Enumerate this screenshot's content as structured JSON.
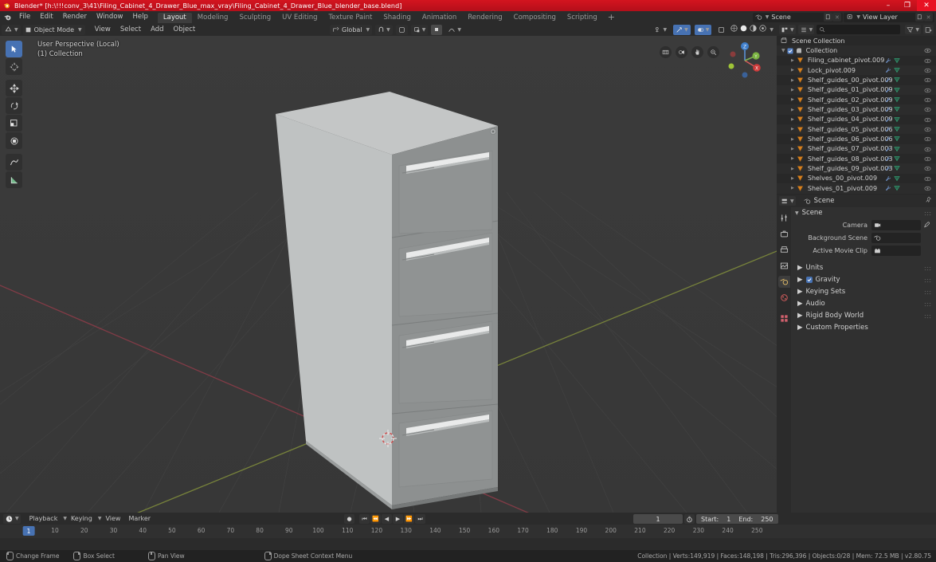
{
  "window": {
    "title": "Blender* [h:\\!!!conv_3\\41\\Filing_Cabinet_4_Drawer_Blue_max_vray\\Filing_Cabinet_4_Drawer_Blue_blender_base.blend]",
    "minimize": "–",
    "maximize": "❐",
    "close": "✕",
    "accent_color": "#c1121f"
  },
  "topbar": {
    "menus": [
      "File",
      "Edit",
      "Render",
      "Window",
      "Help"
    ],
    "workspaces": [
      {
        "label": "Layout",
        "active": true
      },
      {
        "label": "Modeling",
        "active": false
      },
      {
        "label": "Sculpting",
        "active": false
      },
      {
        "label": "UV Editing",
        "active": false
      },
      {
        "label": "Texture Paint",
        "active": false
      },
      {
        "label": "Shading",
        "active": false
      },
      {
        "label": "Animation",
        "active": false
      },
      {
        "label": "Rendering",
        "active": false
      },
      {
        "label": "Compositing",
        "active": false
      },
      {
        "label": "Scripting",
        "active": false
      }
    ],
    "add_workspace": "+",
    "scene_name": "Scene",
    "view_layer_name": "View Layer"
  },
  "viewport": {
    "mode": "Object Mode",
    "menus": [
      "View",
      "Select",
      "Add",
      "Object"
    ],
    "transform_orientation": "Global",
    "overlay_text_line1": "User Perspective (Local)",
    "overlay_text_line2": "(1) Collection",
    "tools": [
      {
        "name": "tweak-select-tool",
        "active": true
      },
      {
        "name": "cursor-tool",
        "active": false
      },
      {
        "name": "move-tool",
        "active": false
      },
      {
        "name": "rotate-tool",
        "active": false
      },
      {
        "name": "scale-tool",
        "active": false
      },
      {
        "name": "transform-tool",
        "active": false
      },
      {
        "name": "annotate-tool",
        "active": false
      },
      {
        "name": "measure-tool",
        "active": false
      }
    ],
    "gizmo_axes": [
      "X",
      "Y",
      "Z"
    ],
    "background_color": "#393939"
  },
  "outliner": {
    "display_mode": "View Layer",
    "search_placeholder": "",
    "root": "Scene Collection",
    "collection": "Collection",
    "items": [
      {
        "label": "Filing_cabinet_pivot.009",
        "modifier": true,
        "mesh": true
      },
      {
        "label": "Lock_pivot.009",
        "modifier": true,
        "mesh": true
      },
      {
        "label": "Shelf_guides_00_pivot.009",
        "modifier": true,
        "mesh": true
      },
      {
        "label": "Shelf_guides_01_pivot.009",
        "modifier": true,
        "mesh": true
      },
      {
        "label": "Shelf_guides_02_pivot.009",
        "modifier": true,
        "mesh": true
      },
      {
        "label": "Shelf_guides_03_pivot.009",
        "modifier": true,
        "mesh": true
      },
      {
        "label": "Shelf_guides_04_pivot.009",
        "modifier": true,
        "mesh": true
      },
      {
        "label": "Shelf_guides_05_pivot.006",
        "modifier": true,
        "mesh": true
      },
      {
        "label": "Shelf_guides_06_pivot.006",
        "modifier": true,
        "mesh": true
      },
      {
        "label": "Shelf_guides_07_pivot.003",
        "modifier": true,
        "mesh": true
      },
      {
        "label": "Shelf_guides_08_pivot.003",
        "modifier": true,
        "mesh": true
      },
      {
        "label": "Shelf_guides_09_pivot.003",
        "modifier": true,
        "mesh": true
      },
      {
        "label": "Shelves_00_pivot.009",
        "modifier": true,
        "mesh": true
      },
      {
        "label": "Shelves_01_pivot.009",
        "modifier": true,
        "mesh": true
      }
    ]
  },
  "properties": {
    "breadcrumb": "Scene",
    "panel_scene": "Scene",
    "rows": [
      {
        "label": "Camera",
        "value": "",
        "icon": "camera-icon",
        "eyedropper": true
      },
      {
        "label": "Background Scene",
        "value": "",
        "icon": "scene-icon",
        "eyedropper": false
      },
      {
        "label": "Active Movie Clip",
        "value": "",
        "icon": "clip-icon",
        "eyedropper": false
      }
    ],
    "sections": [
      {
        "label": "Units",
        "checkbox": false
      },
      {
        "label": "Gravity",
        "checkbox": true
      },
      {
        "label": "Keying Sets",
        "checkbox": false
      },
      {
        "label": "Audio",
        "checkbox": false
      },
      {
        "label": "Rigid Body World",
        "checkbox": false
      },
      {
        "label": "Custom Properties",
        "checkbox": false
      }
    ]
  },
  "timeline": {
    "menus": [
      "Playback",
      "Keying",
      "View",
      "Marker"
    ],
    "current_frame": "1",
    "start_label": "Start:",
    "start_value": "1",
    "end_label": "End:",
    "end_value": "250",
    "ticks": [
      10,
      20,
      30,
      40,
      50,
      60,
      70,
      80,
      90,
      100,
      110,
      120,
      130,
      140,
      150,
      160,
      170,
      180,
      190,
      200,
      210,
      220,
      230,
      240,
      250
    ],
    "playhead_label": "1"
  },
  "statusbar": {
    "hints": [
      {
        "mouse": "l",
        "label": "Change Frame"
      },
      {
        "mouse": "r",
        "label": "Box Select"
      },
      {
        "mouse": "m",
        "label": "Pan View"
      },
      {
        "mouse": "r",
        "label": "Dope Sheet Context Menu"
      }
    ],
    "stats": "Collection | Verts:149,919 | Faces:148,198 | Tris:296,396 | Objects:0/28 | Mem: 72.5 MB | v2.80.75"
  }
}
